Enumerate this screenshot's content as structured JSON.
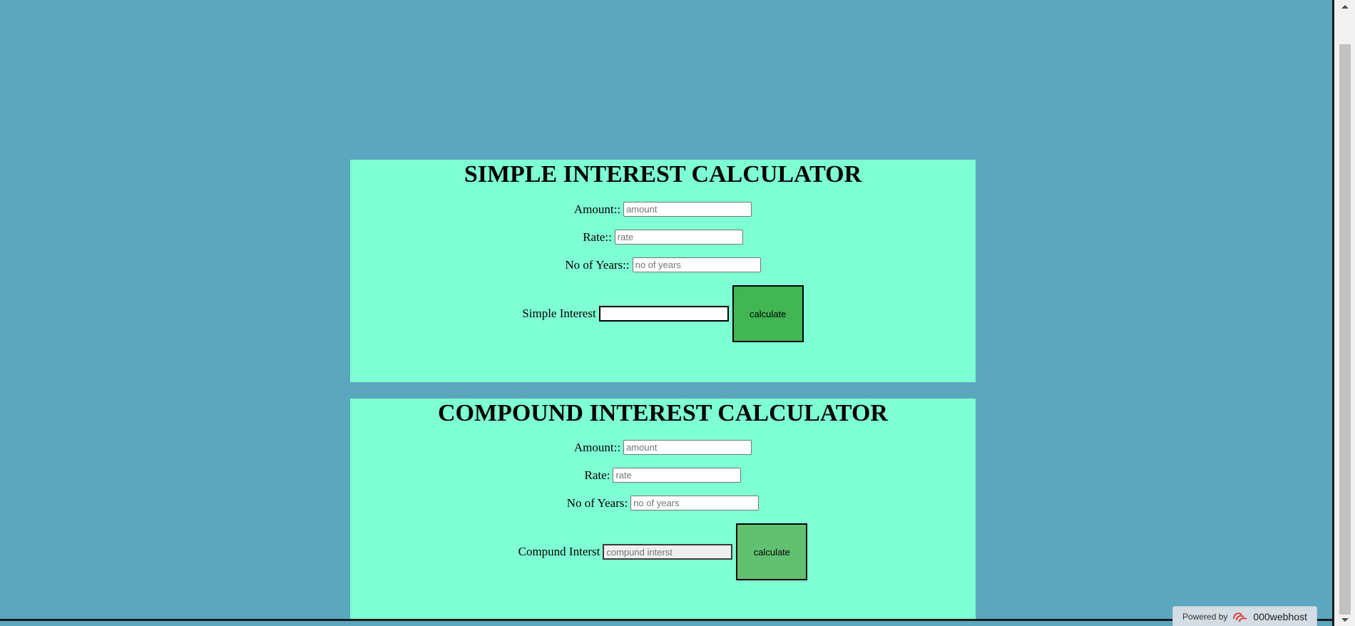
{
  "simple": {
    "title": "SIMPLE INTEREST CALCULATOR",
    "amount_label": "Amount::",
    "amount_placeholder": "amount",
    "rate_label": "Rate::",
    "rate_placeholder": "rate",
    "years_label": "No of Years::",
    "years_placeholder": "no of years",
    "result_label": "Simple Interest",
    "result_value": "",
    "button_label": "calculate",
    "button_color": "#41b653"
  },
  "compound": {
    "title": "COMPOUND INTEREST CALCULATOR",
    "amount_label": "Amount::",
    "amount_placeholder": "amount",
    "rate_label": "Rate:",
    "rate_placeholder": "rate",
    "years_label": "No of Years:",
    "years_placeholder": "no of years",
    "result_label": "Compund Interst",
    "result_placeholder": "compund interst",
    "button_label": "calculate",
    "button_color": "#61c170"
  },
  "footer": {
    "powered_text": "Powered by",
    "brand": "000webhost",
    "logo_icon": "000webhost-logo-icon"
  },
  "colors": {
    "page_background": "#5aa7bf",
    "panel_background": "#7fffd4"
  }
}
